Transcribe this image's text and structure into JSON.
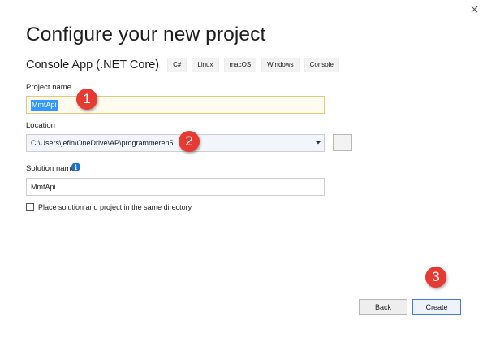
{
  "dialog": {
    "title": "Configure your new project",
    "close_icon": "close-icon"
  },
  "template": {
    "name": "Console App (.NET Core)",
    "tags": [
      "C#",
      "Linux",
      "macOS",
      "Windows",
      "Console"
    ]
  },
  "project_name": {
    "label": "Project name",
    "value": "MmtApi"
  },
  "location": {
    "label": "Location",
    "value": "C:\\Users\\jefin\\OneDrive\\AP\\programmeren5",
    "browse_label": "..."
  },
  "solution_name": {
    "label": "Solution name",
    "value": "MmtApi",
    "info_icon": "info-icon"
  },
  "same_directory": {
    "label": "Place solution and project in the same directory",
    "checked": false
  },
  "buttons": {
    "back": "Back",
    "create": "Create"
  },
  "markers": [
    "1",
    "2",
    "3"
  ],
  "colors": {
    "marker": "#e53b33",
    "info": "#1a73c8",
    "selection": "#3399ff",
    "primary_border": "#3e7dd3"
  }
}
